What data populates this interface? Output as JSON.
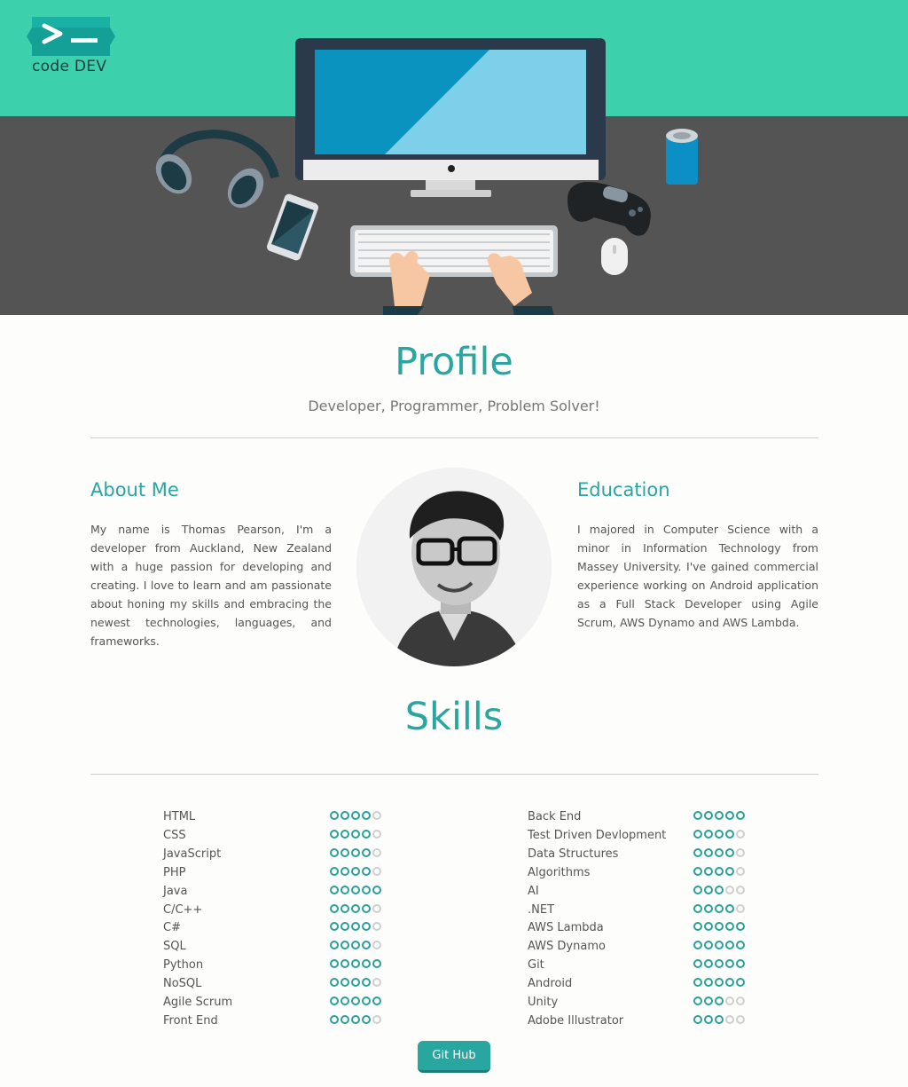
{
  "brand": {
    "logo_label": "code DEV"
  },
  "profile": {
    "title": "Profile",
    "subtitle": "Developer, Programmer, Problem Solver!"
  },
  "about": {
    "title": "About Me",
    "text": "My name is Thomas Pearson, I'm a developer from Auckland, New Zealand with a huge passion for developing and creating. I love to learn and am passionate about honing my skills and embracing the newest technologies, languages, and frameworks."
  },
  "education": {
    "title": "Education",
    "text": "I majored in Computer Science with a minor in Information Technology from Massey University. I've gained commercial experience working on Android application as a Full Stack Developer using Agile Scrum, AWS Dynamo and AWS Lambda."
  },
  "skills": {
    "title": "Skills",
    "max_rating": 5,
    "left": [
      {
        "name": "HTML",
        "rating": 4
      },
      {
        "name": "CSS",
        "rating": 4
      },
      {
        "name": "JavaScript",
        "rating": 4
      },
      {
        "name": "PHP",
        "rating": 4
      },
      {
        "name": "Java",
        "rating": 5
      },
      {
        "name": "C/C++",
        "rating": 4
      },
      {
        "name": "C#",
        "rating": 4
      },
      {
        "name": "SQL",
        "rating": 4
      },
      {
        "name": "Python",
        "rating": 5
      },
      {
        "name": "NoSQL",
        "rating": 4
      },
      {
        "name": "Agile Scrum",
        "rating": 5
      },
      {
        "name": "Front End",
        "rating": 4
      }
    ],
    "right": [
      {
        "name": "Back End",
        "rating": 5
      },
      {
        "name": "Test Driven Devlopment",
        "rating": 4
      },
      {
        "name": "Data Structures",
        "rating": 4
      },
      {
        "name": "Algorithms",
        "rating": 4
      },
      {
        "name": "AI",
        "rating": 3
      },
      {
        "name": ".NET",
        "rating": 4
      },
      {
        "name": "AWS Lambda",
        "rating": 5
      },
      {
        "name": "AWS Dynamo",
        "rating": 5
      },
      {
        "name": "Git",
        "rating": 5
      },
      {
        "name": "Android",
        "rating": 5
      },
      {
        "name": "Unity",
        "rating": 3
      },
      {
        "name": "Adobe Illustrator",
        "rating": 3
      }
    ]
  },
  "github": {
    "label": "Git Hub"
  },
  "colors": {
    "hero_top": "#3dd0ad",
    "hero_desk": "#545454",
    "accent": "#2aa6a0"
  },
  "icons": {
    "logo": "terminal-prompt-icon",
    "rating": "star-rating-icon"
  }
}
